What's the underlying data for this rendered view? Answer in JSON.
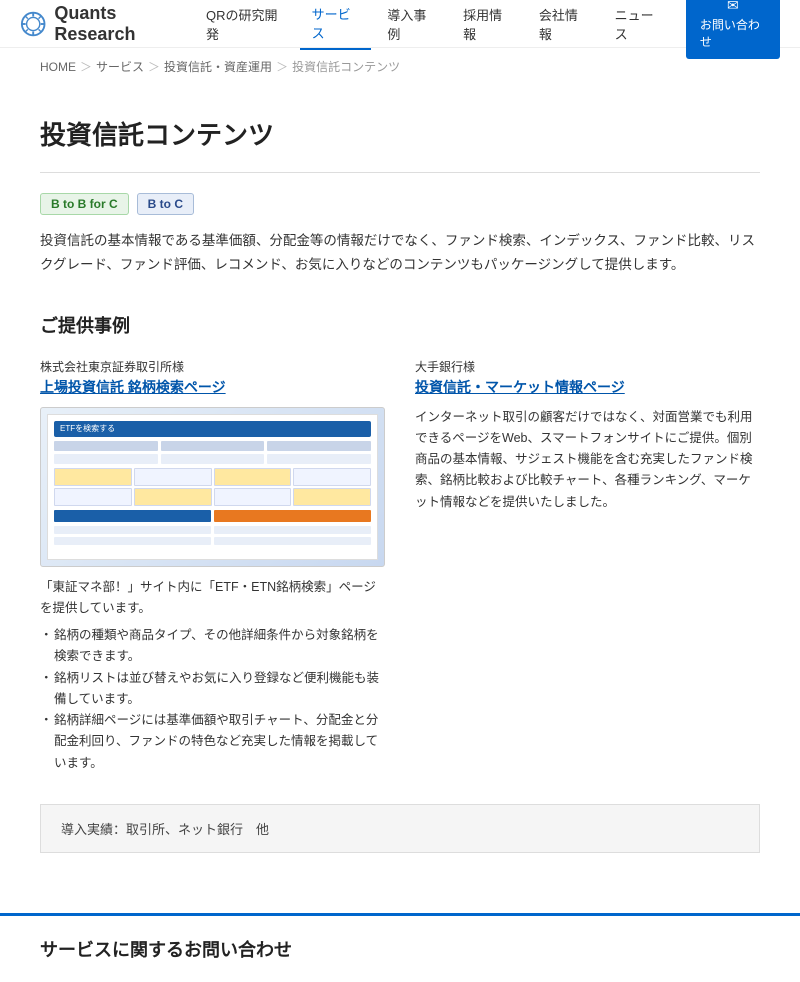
{
  "header": {
    "logo_text": "Quants Research",
    "nav_items": [
      {
        "label": "QRの研究開発",
        "active": false
      },
      {
        "label": "サービス",
        "active": true
      },
      {
        "label": "導入事例",
        "active": false
      },
      {
        "label": "採用情報",
        "active": false
      },
      {
        "label": "会社情報",
        "active": false
      },
      {
        "label": "ニュース",
        "active": false
      }
    ],
    "contact_label": "お問い合わせ"
  },
  "breadcrumb": {
    "items": [
      "HOME",
      "サービス",
      "投資信託・資産運用",
      "投資信託コンテンツ"
    ],
    "separators": [
      "＞",
      "＞",
      "＞"
    ]
  },
  "page": {
    "title": "投資信託コンテンツ",
    "tags": [
      {
        "label": "B to B for C",
        "type": "b2b"
      },
      {
        "label": "B to C",
        "type": "b2c"
      }
    ],
    "intro": "投資信託の基本情報である基準価額、分配金等の情報だけでなく、ファンド検索、インデックス、ファンド比較、リスクグレード、ファンド評価、レコメンド、お気に入りなどのコンテンツもパッケージングして提供します。",
    "cases_section_title": "ご提供事例",
    "cases": [
      {
        "company": "株式会社東京証券取引所様",
        "service_title": "上場投資信託 銘柄検索ページ",
        "desc": "「東証マネ部！」サイト内に「ETF・ETN銘柄検索」ページを提供しています。",
        "bullets": [
          "銘柄の種類や商品タイプ、その他詳細条件から対象銘柄を検索できます。",
          "銘柄リストは並び替えやお気に入り登録など便利機能も装備しています。",
          "銘柄詳細ページには基準価額や取引チャート、分配金と分配金利回り、ファンドの特色など充実した情報を掲載しています。"
        ]
      },
      {
        "company": "大手銀行様",
        "service_title": "投資信託・マーケット情報ページ",
        "desc": "インターネット取引の顧客だけではなく、対面営業でも利用できるページをWeb、スマートフォンサイトにご提供。個別商品の基本情報、サジェスト機能を含む充実したファンド検索、銘柄比較および比較チャート、各種ランキング、マーケット情報などを提供いたしました。",
        "bullets": []
      }
    ],
    "footer_banner": "導入実績：取引所、ネット銀行　他",
    "bottom_section_title": "サービスに関するお問い合わせ"
  }
}
